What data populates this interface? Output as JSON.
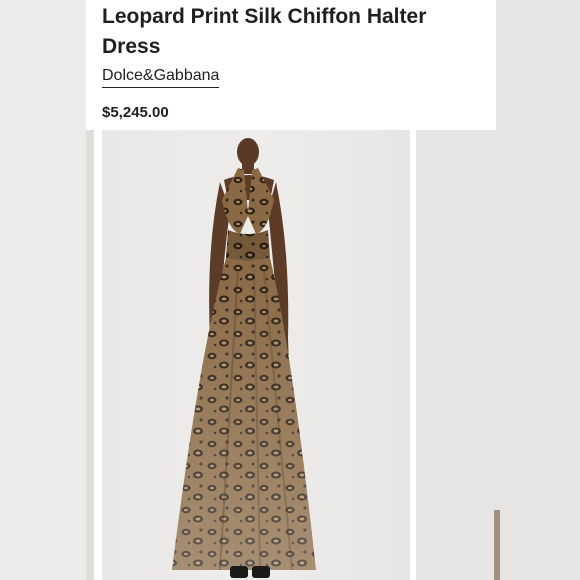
{
  "product": {
    "title": "Leopard Print Silk Chiffon Halter Dress",
    "brand": "Dolce&Gabbana",
    "price": "$5,245.00"
  },
  "gallery": {
    "images": [
      {
        "description": "model wearing leopard print halter maxi dress"
      },
      {
        "description": "next product image (partially visible)"
      }
    ]
  },
  "colors": {
    "text": "#1f1f1f",
    "card_bg": "#ffffff",
    "page_bg": "#e9e8e6",
    "leopard_base": "#8a6a45",
    "leopard_spot": "#2b1f16"
  }
}
